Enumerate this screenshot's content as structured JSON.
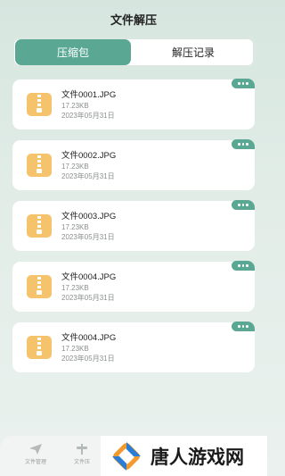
{
  "header": {
    "title": "文件解压"
  },
  "tabs": [
    {
      "label": "压缩包",
      "active": true
    },
    {
      "label": "解压记录",
      "active": false
    }
  ],
  "files": [
    {
      "name": "文件0001.JPG",
      "size": "17.23KB",
      "date": "2023年05月31日"
    },
    {
      "name": "文件0002.JPG",
      "size": "17.23KB",
      "date": "2023年05月31日"
    },
    {
      "name": "文件0003.JPG",
      "size": "17.23KB",
      "date": "2023年05月31日"
    },
    {
      "name": "文件0004.JPG",
      "size": "17.23KB",
      "date": "2023年05月31日"
    },
    {
      "name": "文件0004.JPG",
      "size": "17.23KB",
      "date": "2023年05月31日"
    }
  ],
  "bottom_nav": [
    {
      "label": "文件管理",
      "icon": "send-icon"
    },
    {
      "label": "文件压",
      "icon": "compress-icon"
    }
  ],
  "watermark": {
    "text": "唐人游戏网"
  },
  "colors": {
    "accent": "#5aa894",
    "file_icon": "#f5c36b",
    "background": "#d6e6df"
  }
}
